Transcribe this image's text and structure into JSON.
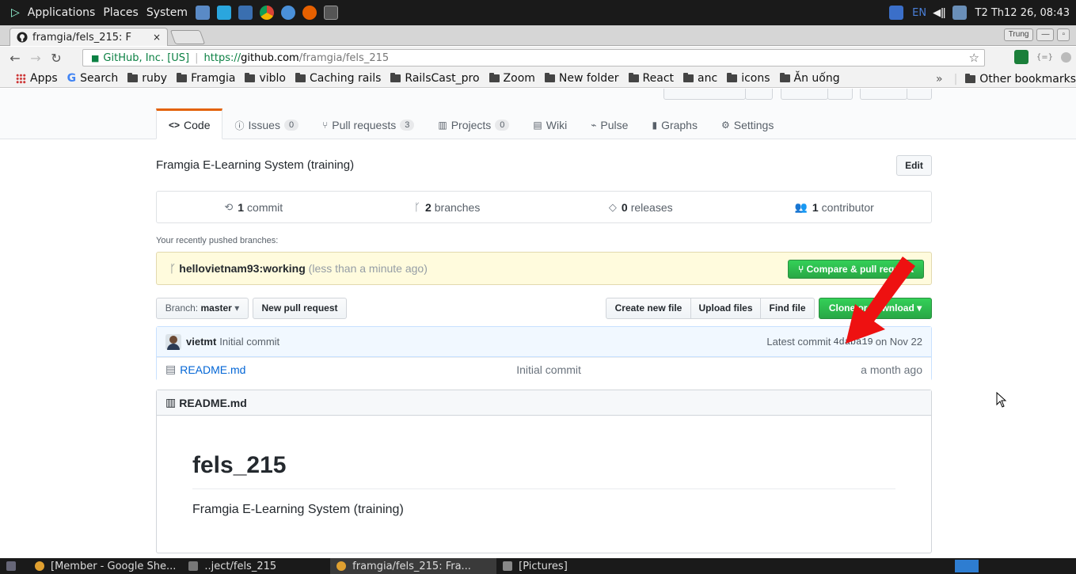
{
  "os_panel": {
    "menus": [
      "Applications",
      "Places",
      "System"
    ],
    "lang": "EN",
    "clock": "T2 Th12 26, 08:43"
  },
  "browser": {
    "tab_title": "framgia/fels_215: F",
    "tab_close": "×",
    "profile_name": "Trung",
    "omnibox": {
      "secure_label": "GitHub, Inc. [US]",
      "url_scheme": "https://",
      "url_host": "github.com",
      "url_path": "/framgia/fels_215"
    },
    "bookmarks": [
      {
        "label": "Apps",
        "icon": "apps-grid-icon"
      },
      {
        "label": "Search",
        "icon": "google-icon"
      },
      {
        "label": "ruby",
        "icon": "folder-icon"
      },
      {
        "label": "Framgia",
        "icon": "folder-icon"
      },
      {
        "label": "viblo",
        "icon": "folder-icon"
      },
      {
        "label": "Caching rails",
        "icon": "folder-icon"
      },
      {
        "label": "RailsCast_pro",
        "icon": "folder-icon"
      },
      {
        "label": "Zoom",
        "icon": "folder-icon"
      },
      {
        "label": "New folder",
        "icon": "folder-icon"
      },
      {
        "label": "React",
        "icon": "folder-icon"
      },
      {
        "label": "anc",
        "icon": "folder-icon"
      },
      {
        "label": "icons",
        "icon": "folder-icon"
      },
      {
        "label": "Ăn uống",
        "icon": "folder-icon"
      }
    ],
    "bookmarks_overflow": "»",
    "other_bookmarks": "Other bookmarks"
  },
  "repo": {
    "nav": [
      {
        "label": "Code",
        "count": null,
        "icon": "code-icon",
        "selected": true
      },
      {
        "label": "Issues",
        "count": "0",
        "icon": "issue-icon"
      },
      {
        "label": "Pull requests",
        "count": "3",
        "icon": "pull-request-icon"
      },
      {
        "label": "Projects",
        "count": "0",
        "icon": "project-icon"
      },
      {
        "label": "Wiki",
        "count": null,
        "icon": "wiki-icon"
      },
      {
        "label": "Pulse",
        "count": null,
        "icon": "pulse-icon"
      },
      {
        "label": "Graphs",
        "count": null,
        "icon": "graph-icon"
      },
      {
        "label": "Settings",
        "count": null,
        "icon": "gear-icon"
      }
    ],
    "description": "Framgia E-Learning System (training)",
    "edit_label": "Edit",
    "numbers": {
      "commits": "1",
      "commits_label": "commit",
      "branches": "2",
      "branches_label": "branches",
      "releases": "0",
      "releases_label": "releases",
      "contributors": "1",
      "contributors_label": "contributor"
    },
    "recent_label": "Your recently pushed branches:",
    "recent_branch": "hellovietnam93:working",
    "recent_ago": "(less than a minute ago)",
    "compare_label": "Compare & pull request",
    "branch_prefix": "Branch:",
    "branch_name": "master",
    "new_pr_label": "New pull request",
    "create_file_label": "Create new file",
    "upload_files_label": "Upload files",
    "find_file_label": "Find file",
    "clone_label": "Clone or download",
    "commit": {
      "author": "vietmt",
      "message": "Initial commit",
      "latest_prefix": "Latest commit",
      "sha": "4daba19",
      "date": "on Nov 22"
    },
    "files": [
      {
        "name": "README.md",
        "message": "Initial commit",
        "age": "a month ago"
      }
    ],
    "readme": {
      "header": "README.md",
      "h1": "fels_215",
      "body": "Framgia E-Learning System (training)"
    }
  },
  "taskbar": {
    "tasks": [
      {
        "label": "[Member - Google She...",
        "active": false
      },
      {
        "label": "..ject/fels_215",
        "active": false
      },
      {
        "label": "framgia/fels_215: Fra...",
        "active": true
      },
      {
        "label": "[Pictures]",
        "active": false
      }
    ]
  },
  "colors": {
    "green": "#28a745",
    "link": "#0366d6",
    "arrow": "#ee1111",
    "nav_accent": "#e36209"
  }
}
